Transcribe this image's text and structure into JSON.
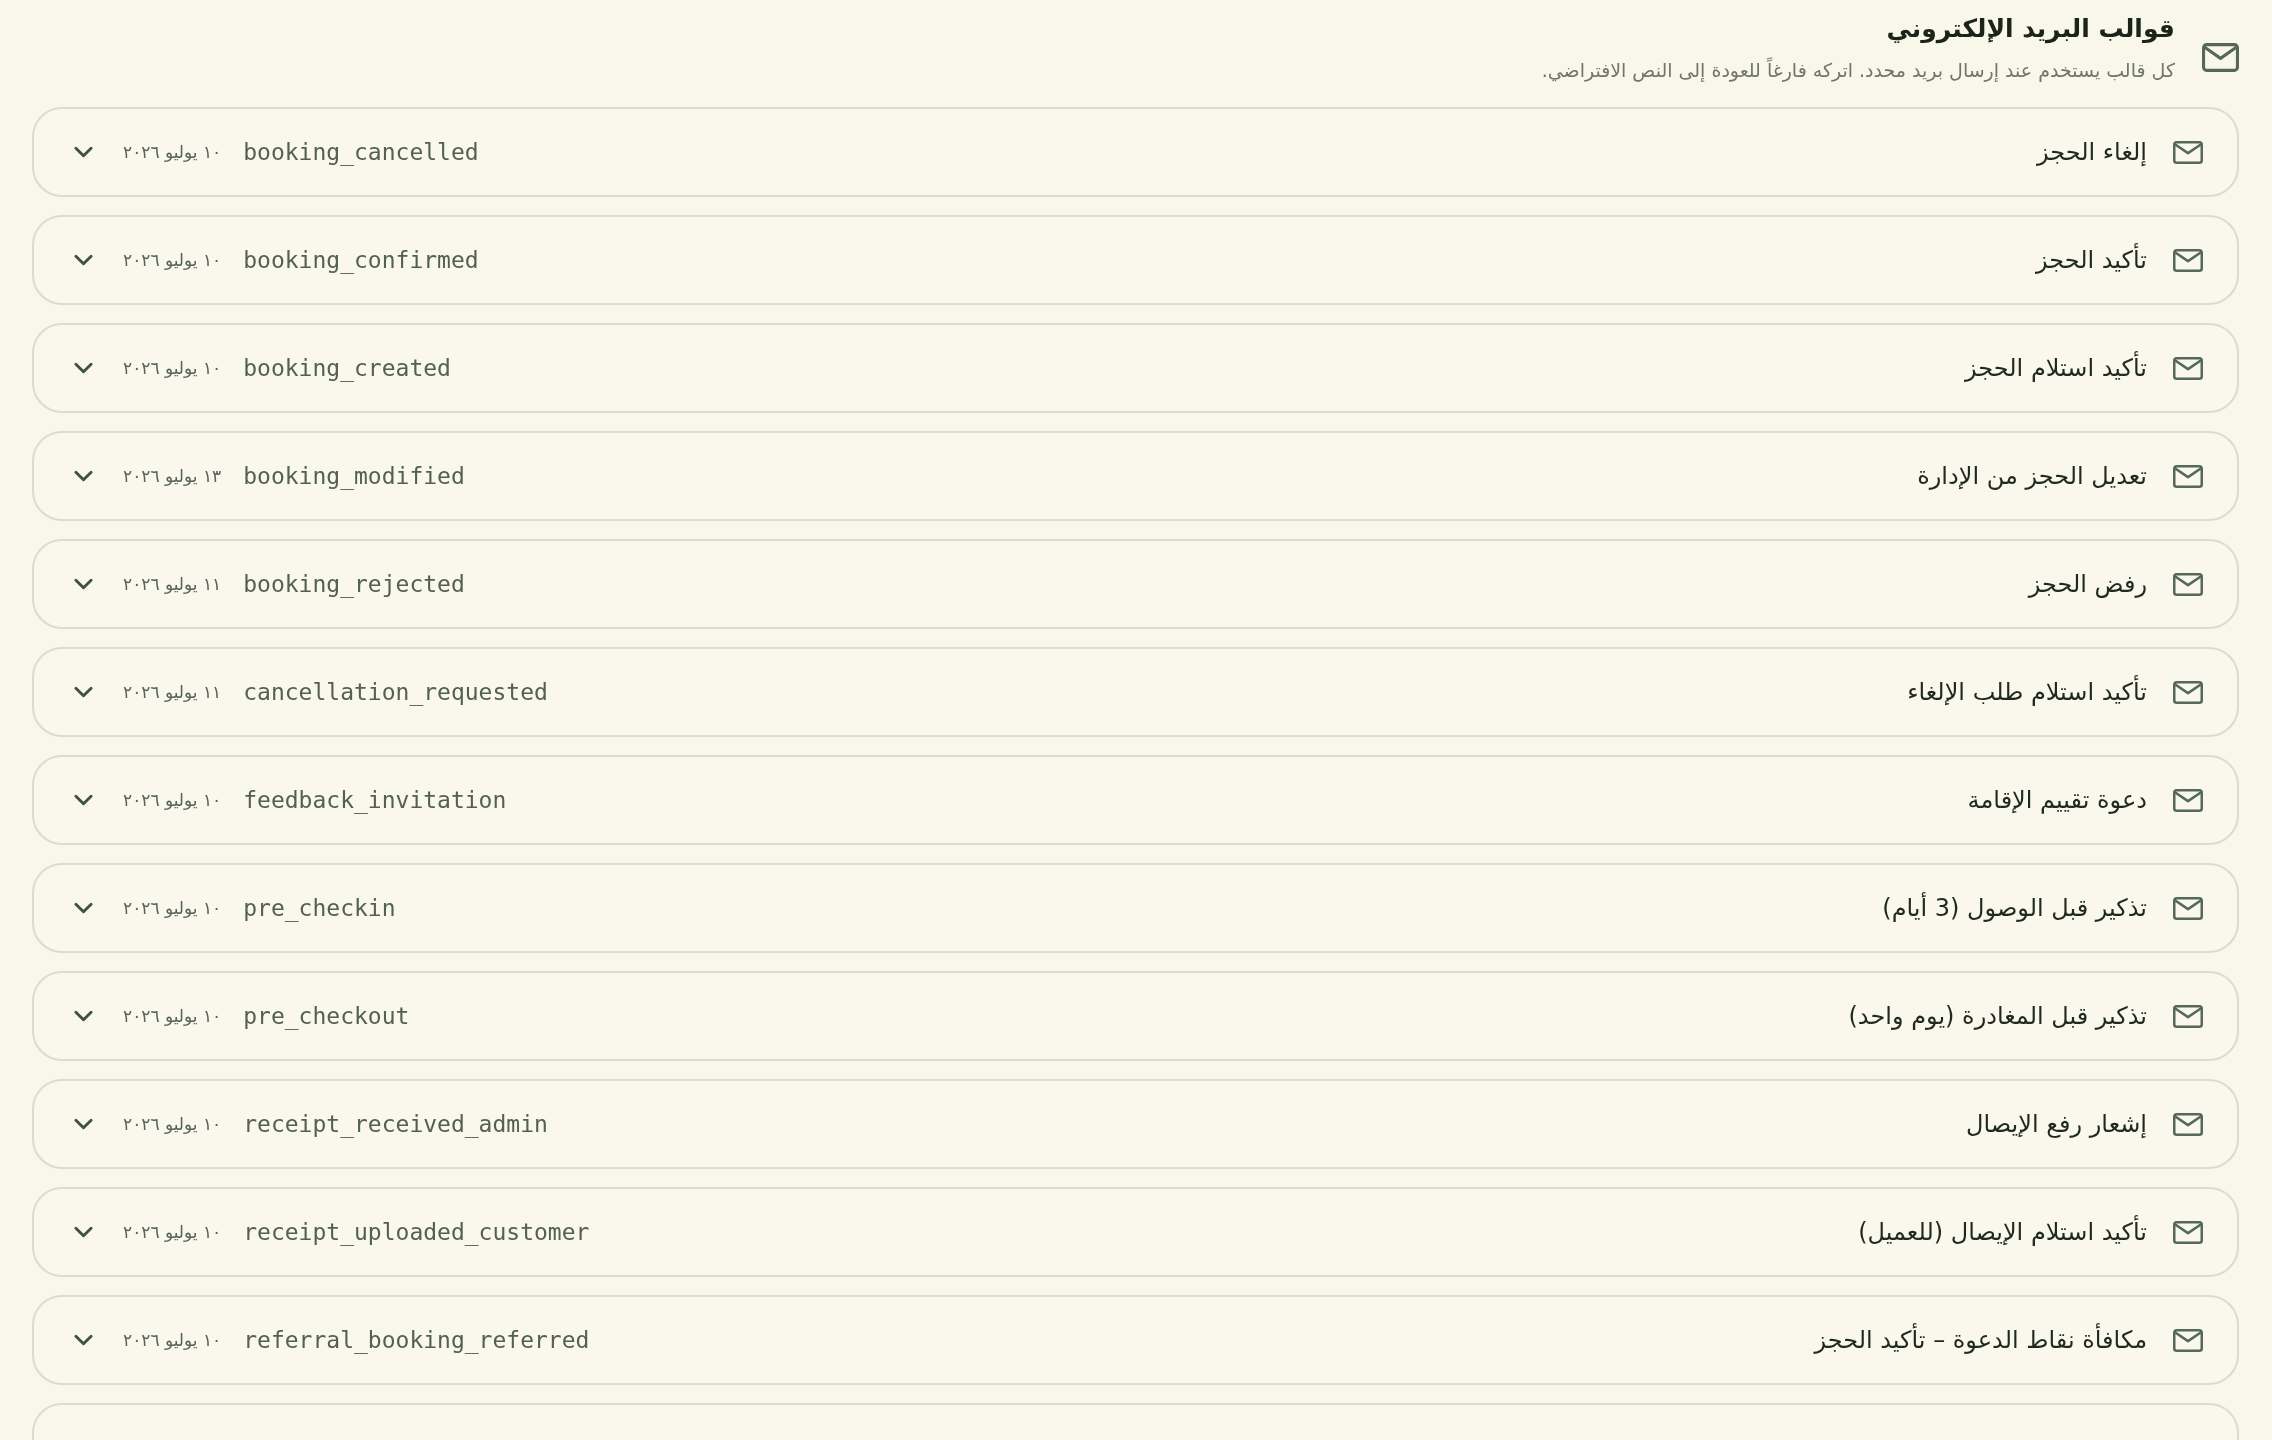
{
  "header": {
    "title": "قوالب البريد الإلكتروني",
    "subtitle": "كل قالب يستخدم عند إرسال بريد محدد. اتركه فارغاً للعودة إلى النص الافتراضي."
  },
  "templates": [
    {
      "kind": "row",
      "title": "إلغاء الحجز",
      "key": "booking_cancelled",
      "date": "١٠ يوليو ٢٠٢٦",
      "expanded": false
    },
    {
      "kind": "row",
      "title": "تأكيد الحجز",
      "key": "booking_confirmed",
      "date": "١٠ يوليو ٢٠٢٦",
      "expanded": false
    },
    {
      "kind": "row",
      "title": "تأكيد استلام الحجز",
      "key": "booking_created",
      "date": "١٠ يوليو ٢٠٢٦",
      "expanded": false
    },
    {
      "kind": "row",
      "title": "تعديل الحجز من الإدارة",
      "key": "booking_modified",
      "date": "١٣ يوليو ٢٠٢٦",
      "expanded": false
    },
    {
      "kind": "row",
      "title": "رفض الحجز",
      "key": "booking_rejected",
      "date": "١١ يوليو ٢٠٢٦",
      "expanded": false
    },
    {
      "kind": "row",
      "title": "تأكيد استلام طلب الإلغاء",
      "key": "cancellation_requested",
      "date": "١١ يوليو ٢٠٢٦",
      "expanded": false
    },
    {
      "kind": "row",
      "title": "دعوة تقييم الإقامة",
      "key": "feedback_invitation",
      "date": "١٠ يوليو ٢٠٢٦",
      "expanded": false
    },
    {
      "kind": "row",
      "title": "تذكير قبل الوصول (3 أيام)",
      "key": "pre_checkin",
      "date": "١٠ يوليو ٢٠٢٦",
      "expanded": false
    },
    {
      "kind": "row",
      "title": "تذكير قبل المغادرة (يوم واحد)",
      "key": "pre_checkout",
      "date": "١٠ يوليو ٢٠٢٦",
      "expanded": false
    },
    {
      "kind": "row",
      "title": "إشعار رفع الإيصال",
      "key": "receipt_received_admin",
      "date": "١٠ يوليو ٢٠٢٦",
      "expanded": false
    },
    {
      "kind": "row",
      "title": "تأكيد استلام الإيصال (للعميل)",
      "key": "receipt_uploaded_customer",
      "date": "١٠ يوليو ٢٠٢٦",
      "expanded": false
    },
    {
      "kind": "row",
      "title": "مكافأة نقاط الدعوة – تأكيد الحجز",
      "key": "referral_booking_referred",
      "date": "١٠ يوليو ٢٠٢٦",
      "expanded": false
    },
    {
      "kind": "cut"
    }
  ]
}
